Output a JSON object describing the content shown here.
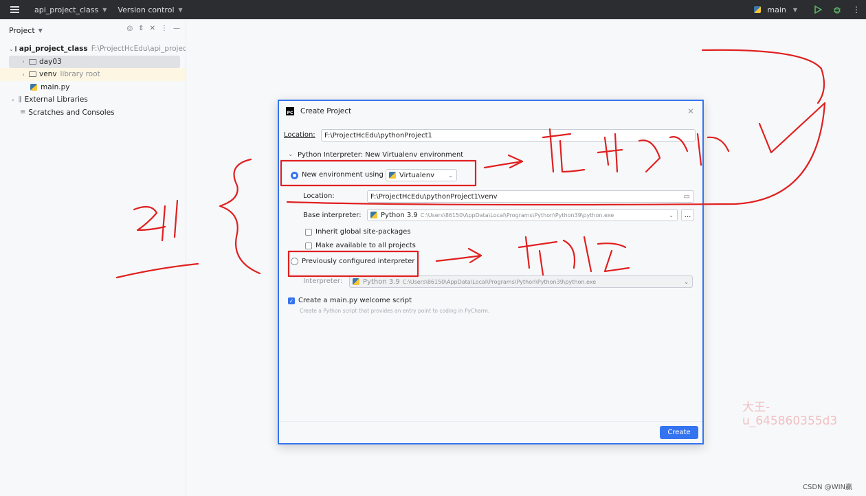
{
  "titlebar": {
    "project_name": "api_project_class",
    "vcs": "Version control",
    "branch": "main"
  },
  "project_panel": {
    "title": "Project",
    "items": [
      {
        "label": "api_project_class",
        "hint": "F:\\ProjectHcEdu\\api_project_c"
      },
      {
        "label": "day03",
        "hint": ""
      },
      {
        "label": "venv",
        "hint": "library root"
      },
      {
        "label": "main.py",
        "hint": ""
      },
      {
        "label": "External Libraries",
        "hint": ""
      },
      {
        "label": "Scratches and Consoles",
        "hint": ""
      }
    ]
  },
  "dialog": {
    "title": "Create Project",
    "location_label": "Location:",
    "location_value": "F:\\ProjectHcEdu\\pythonProject1",
    "interpreter_section": "Python Interpreter: New Virtualenv environment",
    "new_env_label": "New environment using",
    "new_env_tool": "Virtualenv",
    "env_location_label": "Location:",
    "env_location_value": "F:\\ProjectHcEdu\\pythonProject1\\venv",
    "base_interp_label": "Base interpreter:",
    "base_interp_name": "Python 3.9",
    "base_interp_path": "C:\\Users\\86150\\AppData\\Local\\Programs\\Python\\Python39\\python.exe",
    "inherit_label": "Inherit global site-packages",
    "make_available_label": "Make available to all projects",
    "prev_interp_label": "Previously configured interpreter",
    "interp_label": "Interpreter:",
    "interp_name": "Python 3.9",
    "interp_path": "C:\\Users\\86150\\AppData\\Local\\Programs\\Python\\Python39\\python.exe",
    "welcome_label": "Create a main.py welcome script",
    "welcome_hint": "Create a Python script that provides an entry point to coding in PyCharm.",
    "create_button": "Create",
    "browse_button": "..."
  },
  "watermarks": {
    "user": "大王- u_645860355d3",
    "csdn": "CSDN @WIN赢"
  },
  "colors": {
    "accent": "#3574f0",
    "annotation": "#e02020",
    "titlebar": "#2b2d30"
  }
}
